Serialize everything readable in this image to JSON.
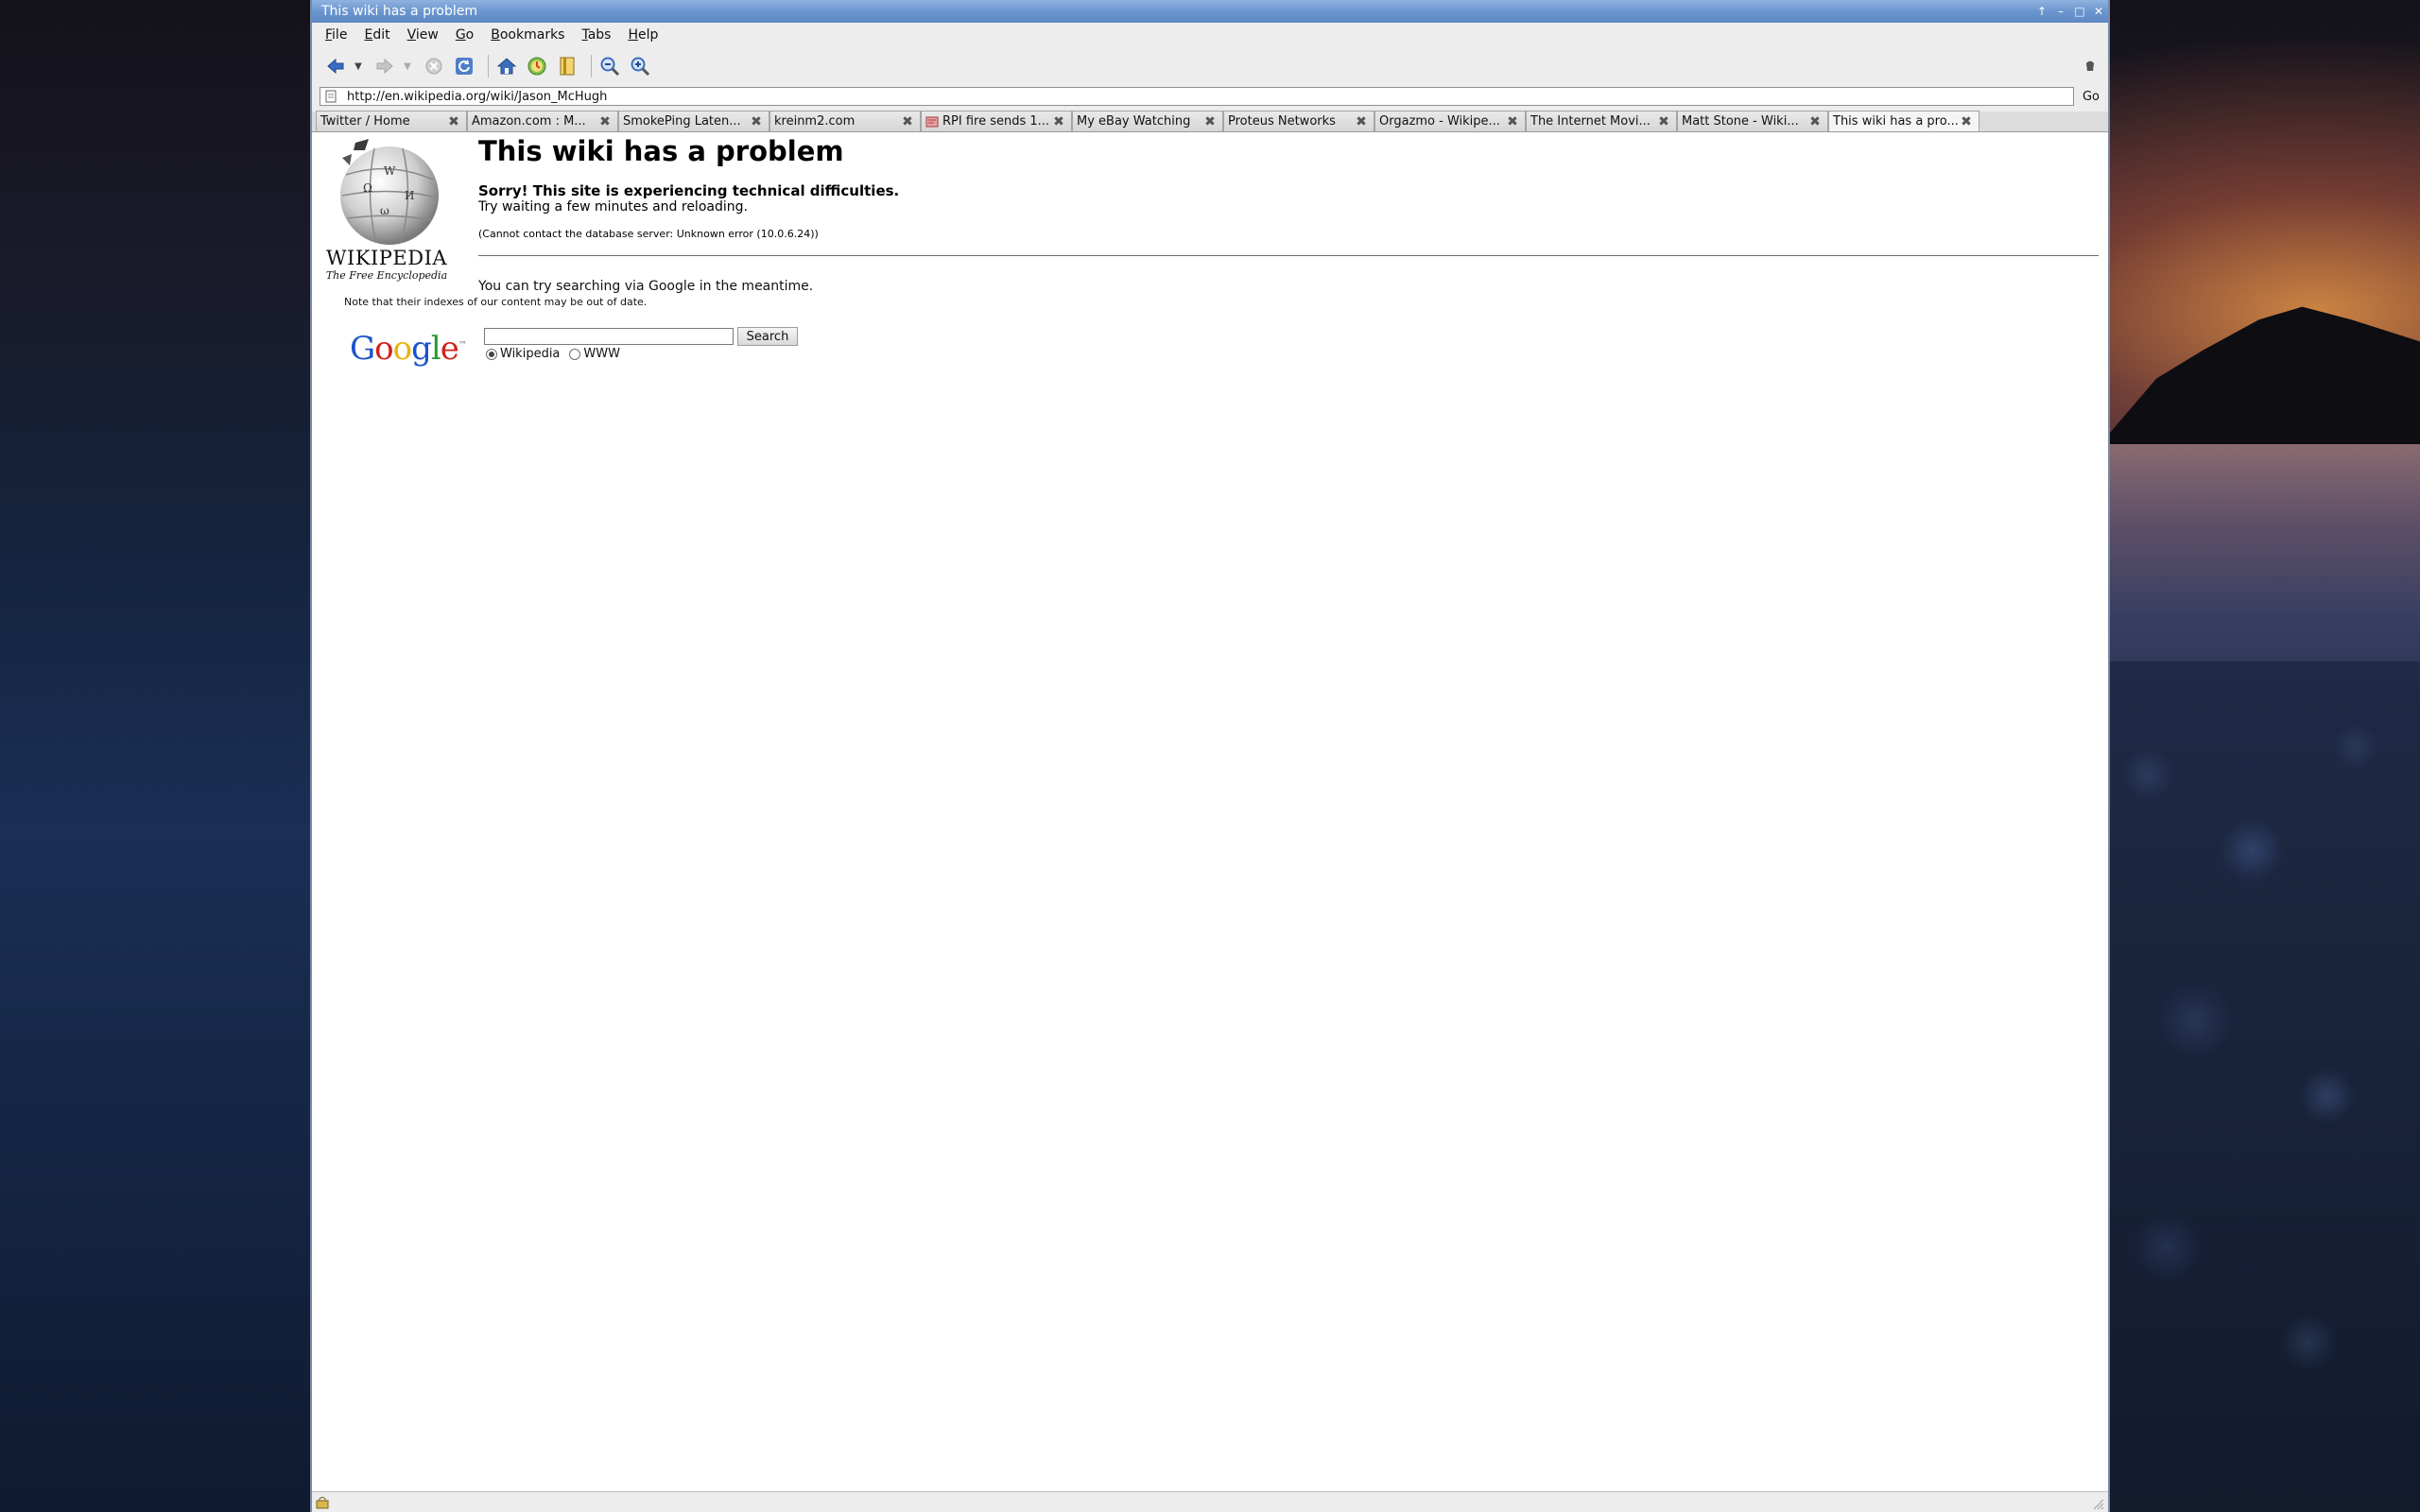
{
  "window": {
    "title": "This wiki has a problem"
  },
  "menu": [
    "File",
    "Edit",
    "View",
    "Go",
    "Bookmarks",
    "Tabs",
    "Help"
  ],
  "toolbar": {
    "icons": [
      "back-icon",
      "forward-icon",
      "stop-icon",
      "reload-icon",
      "home-icon",
      "history-icon",
      "bookmarks-icon",
      "zoom-out-icon",
      "zoom-in-icon"
    ]
  },
  "urlbar": {
    "url": "http://en.wikipedia.org/wiki/Jason_McHugh",
    "go_label": "Go"
  },
  "tabs": [
    {
      "label": "Twitter / Home",
      "active": false
    },
    {
      "label": "Amazon.com : M...",
      "active": false
    },
    {
      "label": "SmokePing Laten...",
      "active": false
    },
    {
      "label": "kreinm2.com",
      "active": false
    },
    {
      "label": "RPI fire sends 1...",
      "active": false
    },
    {
      "label": "My eBay Watching",
      "active": false
    },
    {
      "label": "Proteus Networks",
      "active": false
    },
    {
      "label": "Orgazmo - Wikipe...",
      "active": false
    },
    {
      "label": "The Internet Movi...",
      "active": false
    },
    {
      "label": "Matt Stone - Wiki...",
      "active": false
    },
    {
      "label": "This wiki has a pro...",
      "active": true
    }
  ],
  "page": {
    "wiki_wordmark": "WIKIPEDIA",
    "wiki_tagline": "The Free Encyclopedia",
    "title": "This wiki has a problem",
    "sorry": "Sorry! This site is experiencing technical difficulties.",
    "retry": "Try waiting a few minutes and reloading.",
    "db_error": "(Cannot contact the database server: Unknown error (10.0.6.24))",
    "google_intro": "You can try searching via Google in the meantime.",
    "index_note": "Note that their indexes of our content may be out of date.",
    "search_value": "",
    "search_button": "Search",
    "radio_wikipedia": "Wikipedia",
    "radio_www": "WWW",
    "selected_radio": "Wikipedia"
  },
  "colors": {
    "titlebar": "#6b96cf",
    "chrome": "#ededed",
    "content_bg": "#ffffff"
  }
}
